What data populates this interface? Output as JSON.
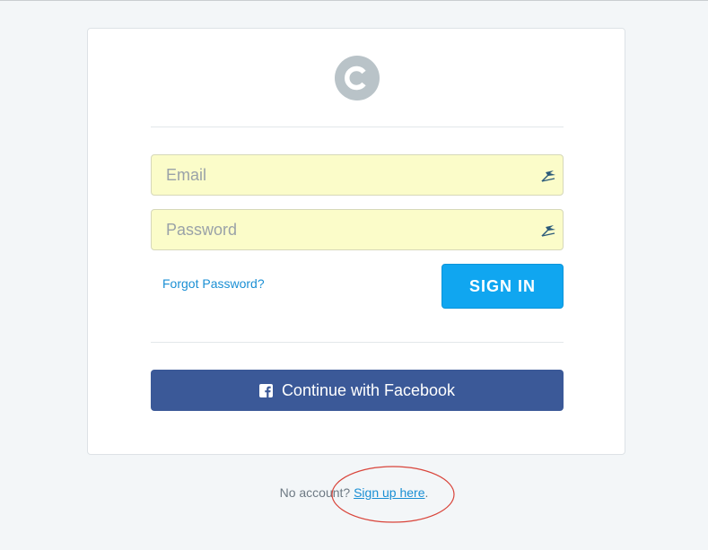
{
  "colors": {
    "background": "#f3f6f8",
    "field_autofill": "#fbfcc9",
    "signin_button": "#10a6f0",
    "facebook_button": "#3b5998",
    "link": "#1a8fd4",
    "logo": "#b9c3c8",
    "annotation_circle": "#d9443a"
  },
  "logo": {
    "icon": "brand-c-logo-icon"
  },
  "form": {
    "email_placeholder": "Email",
    "email_value": "",
    "password_placeholder": "Password",
    "password_value": "",
    "password_manager_icon": "lastpass-icon",
    "forgot_password": "Forgot Password?",
    "sign_in_label": "SIGN IN"
  },
  "facebook": {
    "label": "Continue with Facebook",
    "icon": "facebook-icon"
  },
  "footer": {
    "prefix": "No account?",
    "link": "Sign up here",
    "suffix": "."
  }
}
